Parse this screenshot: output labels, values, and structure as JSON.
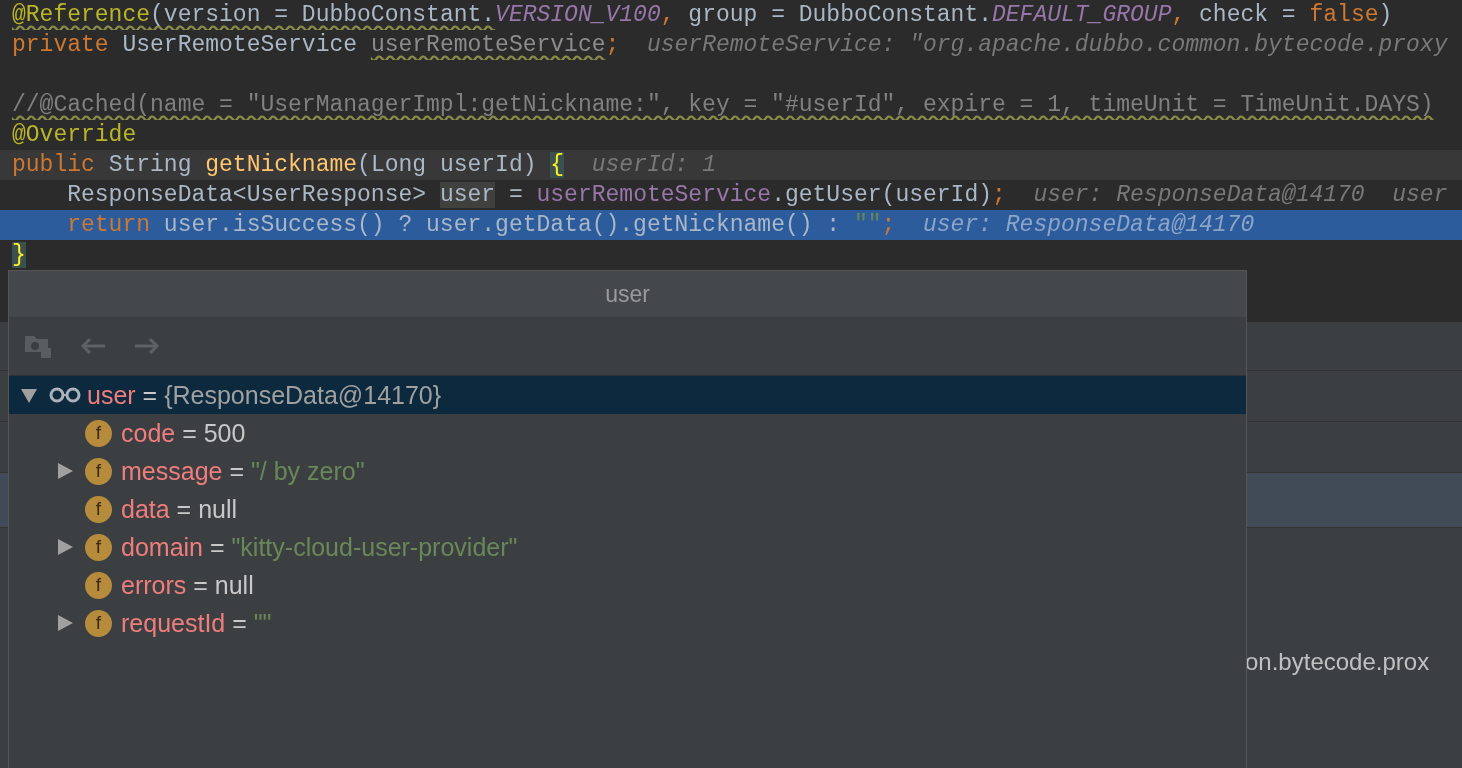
{
  "editor": {
    "lines": [
      {
        "selected": false,
        "current": false,
        "tokens": [
          {
            "kind": "annotation",
            "text": "@Reference",
            "warn": true
          },
          {
            "kind": "plain",
            "text": "(version = DubboConstant.",
            "warn": true
          },
          {
            "kind": "constant",
            "text": "VERSION_V100"
          },
          {
            "kind": "keyword",
            "text": ", "
          },
          {
            "kind": "plain",
            "text": "group = DubboConstant."
          },
          {
            "kind": "constant",
            "text": "DEFAULT_GROUP"
          },
          {
            "kind": "keyword",
            "text": ", "
          },
          {
            "kind": "plain",
            "text": "check = "
          },
          {
            "kind": "keyword",
            "text": "false"
          },
          {
            "kind": "plain",
            "text": ")"
          }
        ]
      },
      {
        "selected": false,
        "current": false,
        "tokens": [
          {
            "kind": "keyword",
            "text": "private "
          },
          {
            "kind": "plain",
            "text": "UserRemoteService "
          },
          {
            "kind": "unused",
            "text": "userRemoteService",
            "warn": true
          },
          {
            "kind": "keyword",
            "text": ";"
          }
        ],
        "hints": [
          "userRemoteService: \"org.apache.dubbo.common.bytecode.proxy"
        ]
      },
      {
        "selected": false,
        "current": false
      },
      {
        "selected": false,
        "current": false,
        "tokens": [
          {
            "kind": "comment",
            "text": "//@Cached(name = \"UserManagerImpl:getNickname:\", key = \"#userId\", expire = 1, timeUnit = TimeUnit.DAYS)",
            "warn": true
          }
        ]
      },
      {
        "selected": false,
        "current": false,
        "tokens": [
          {
            "kind": "annotation",
            "text": "@Override"
          }
        ]
      },
      {
        "selected": false,
        "current": true,
        "tokens": [
          {
            "kind": "keyword",
            "text": "public "
          },
          {
            "kind": "plain",
            "text": "String "
          },
          {
            "kind": "method",
            "text": "getNickname"
          },
          {
            "kind": "plain",
            "text": "(Long userId) "
          },
          {
            "kind": "brace",
            "text": "{"
          }
        ],
        "hints": [
          "userId: 1"
        ]
      },
      {
        "selected": false,
        "current": false,
        "tokens": [
          {
            "kind": "plain",
            "text": "    ResponseData<UserResponse> "
          },
          {
            "kind": "usage",
            "text": "user"
          },
          {
            "kind": "plain",
            "text": " = "
          },
          {
            "kind": "field",
            "text": "userRemoteService"
          },
          {
            "kind": "plain",
            "text": ".getUser(userId)"
          },
          {
            "kind": "keyword",
            "text": ";"
          }
        ],
        "hints": [
          "user: ResponseData@14170",
          "user"
        ]
      },
      {
        "selected": true,
        "current": false,
        "tokens": [
          {
            "kind": "keyword",
            "text": "    return "
          },
          {
            "kind": "plain",
            "text": "user.isSuccess() ? user.getData().getNickname() : "
          },
          {
            "kind": "string",
            "text": "\"\""
          },
          {
            "kind": "keyword",
            "text": ";"
          }
        ],
        "hints": [
          "user: ResponseData@14170"
        ]
      },
      {
        "selected": false,
        "current": false,
        "tokens": [
          {
            "kind": "brace",
            "text": "}"
          }
        ]
      }
    ]
  },
  "background_panel": {
    "text": "on.bytecode.prox"
  },
  "popup": {
    "title": "user",
    "root": {
      "name": "user",
      "operator": "=",
      "value": "{ResponseData@14170}",
      "kind": "object",
      "expanded": true,
      "selected": true,
      "children": [
        {
          "badge": "f",
          "name": "code",
          "operator": "=",
          "value": "500",
          "kind": "plain",
          "selected": false
        },
        {
          "badge": "f",
          "name": "message",
          "operator": "=",
          "value": "\"/ by zero\"",
          "kind": "string",
          "expanded": false,
          "selected": false
        },
        {
          "badge": "f",
          "name": "data",
          "operator": "=",
          "value": "null",
          "kind": "plain",
          "selected": false
        },
        {
          "badge": "f",
          "name": "domain",
          "operator": "=",
          "value": "\"kitty-cloud-user-provider\"",
          "kind": "string",
          "expanded": false,
          "selected": false
        },
        {
          "badge": "f",
          "name": "errors",
          "operator": "=",
          "value": "null",
          "kind": "plain",
          "selected": false
        },
        {
          "badge": "f",
          "name": "requestId",
          "operator": "=",
          "value": "\"\"",
          "kind": "string",
          "expanded": false,
          "selected": false
        }
      ]
    }
  }
}
